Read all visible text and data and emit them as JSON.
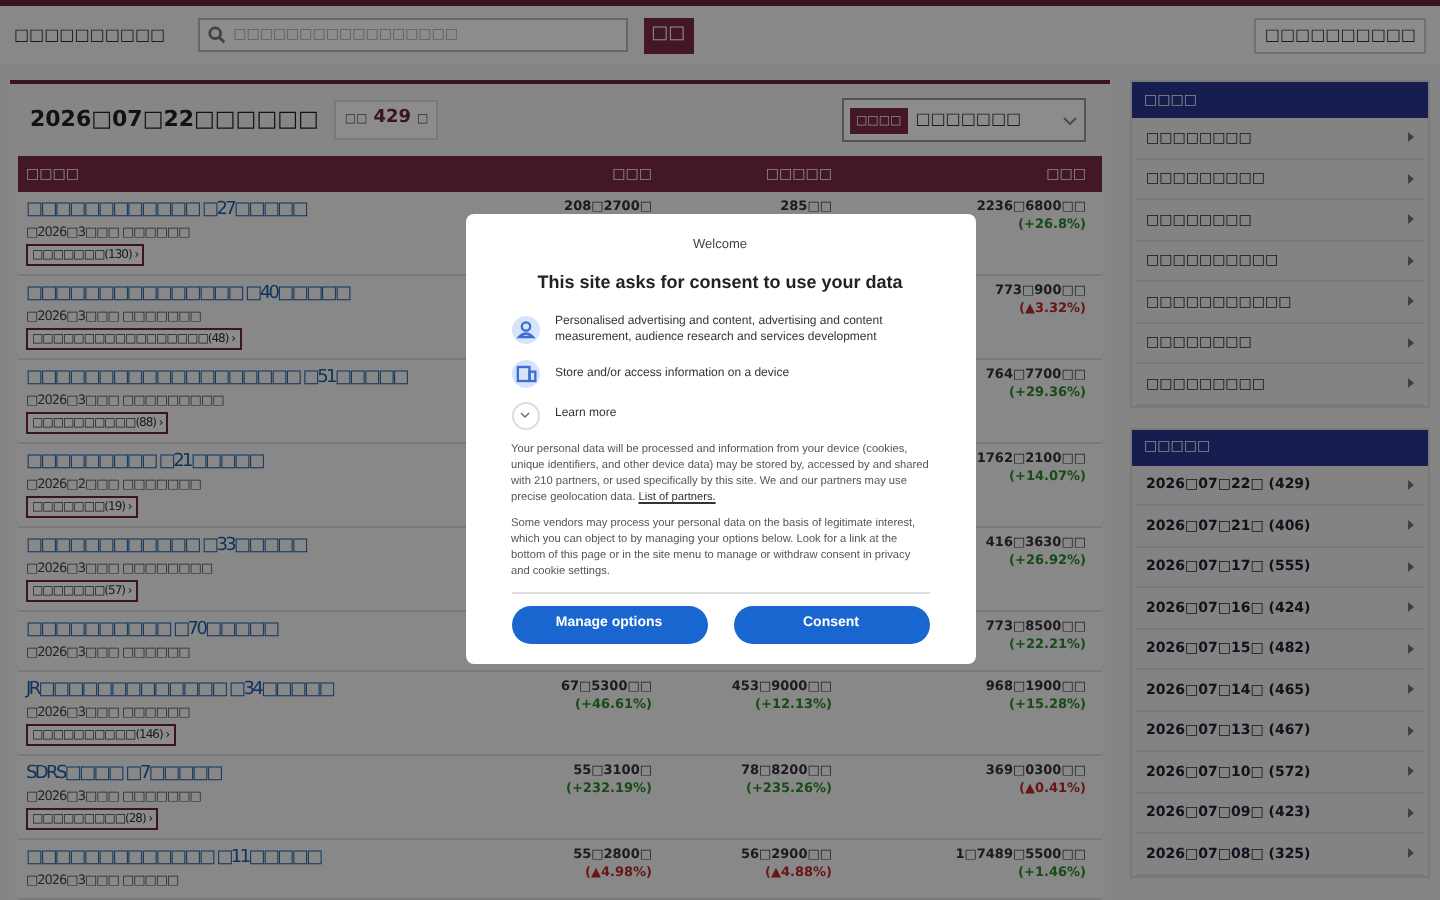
{
  "header": {
    "logo": "□□□□□□□□□□",
    "search": {
      "placeholder": "□□□□□□□□□□□□□□□□□"
    },
    "search_button": "□□",
    "top_link": "□□□□□□□□□□"
  },
  "panel": {
    "title": "2026□07□22□□□□□□",
    "count_prefix": "□□",
    "count": "429",
    "count_suffix": "□",
    "sort": {
      "label": "□□□□",
      "value": "□□□□□□□"
    }
  },
  "table": {
    "columns": [
      "□□□□",
      "□□□",
      "□□□□□",
      "□□□"
    ],
    "rows": [
      {
        "cells": [
          {
            "name": "□□□□□□□□□□□□ □27□□□□□",
            "date": "□2026□3□□□ □□□□□□",
            "tag": "□□□□□□□(130) ›"
          },
          {
            "value": "208□2700□"
          },
          {
            "value": "285□□"
          },
          {
            "value": "2236□6800□□",
            "change": "(+26.8%)",
            "kind": "up"
          }
        ]
      },
      {
        "cells": [
          {
            "name": "□□□□□□□□□□□□□□□ □40□□□□□",
            "date": "□2026□3□□□ □□□□□□□",
            "tag": "□□□□□□□□□□□□□□□□□(48) ›"
          },
          null,
          null,
          {
            "value": "773□900□□",
            "change": "(▲3.32%)",
            "kind": "down"
          }
        ]
      },
      {
        "cells": [
          {
            "name": "□□□□□□□□□□□□□□□□□□□ □51□□□□□",
            "date": "□2026□3□□□ □□□□□□□□□",
            "tag": "□□□□□□□□□□(88) ›"
          },
          null,
          null,
          {
            "value": "764□7700□□",
            "change": "(+29.36%)",
            "kind": "up"
          }
        ]
      },
      {
        "cells": [
          {
            "name": "□□□□□□□□□ □21□□□□□",
            "date": "□2026□2□□□ □□□□□□□",
            "tag": "□□□□□□□(19) ›"
          },
          null,
          null,
          {
            "value": "1762□2100□□",
            "change": "(+14.07%)",
            "kind": "up"
          }
        ]
      },
      {
        "cells": [
          {
            "name": "□□□□□□□□□□□□ □33□□□□□",
            "date": "□2026□3□□□ □□□□□□□□",
            "tag": "□□□□□□□(57) ›"
          },
          null,
          null,
          {
            "value": "416□3630□□",
            "change": "(+26.92%)",
            "kind": "up"
          }
        ]
      },
      {
        "cells": [
          {
            "name": "□□□□□□□□□□ □70□□□□□",
            "date": "□2026□3□□□ □□□□□□"
          },
          null,
          null,
          {
            "value": "773□8500□□",
            "change": "(+22.21%)",
            "kind": "up"
          }
        ]
      },
      {
        "cells": [
          {
            "name": "JR□□□□□□□□□□□□□ □34□□□□□",
            "date": "□2026□3□□□ □□□□□□",
            "tag": "□□□□□□□□□□(146) ›"
          },
          {
            "value": "67□5300□□",
            "change": "(+46.61%)",
            "kind": "up"
          },
          {
            "value": "453□9000□□",
            "change": "(+12.13%)",
            "kind": "up"
          },
          {
            "value": "968□1900□□",
            "change": "(+15.28%)",
            "kind": "up"
          }
        ]
      },
      {
        "cells": [
          {
            "name": "SDRS□□□□ □7□□□□□",
            "date": "□2026□3□□□ □□□□□□□",
            "tag": "□□□□□□□□□(28) ›"
          },
          {
            "value": "55□3100□",
            "change": "(+232.19%)",
            "kind": "up"
          },
          {
            "value": "78□8200□□",
            "change": "(+235.26%)",
            "kind": "up"
          },
          {
            "value": "369□0300□□",
            "change": "(▲0.41%)",
            "kind": "down"
          }
        ]
      },
      {
        "cells": [
          {
            "name": "□□□□□□□□□□□□□ □11□□□□□",
            "date": "□2026□3□□□ □□□□□"
          },
          {
            "value": "55□2800□",
            "change": "(▲4.98%)",
            "kind": "down"
          },
          {
            "value": "56□2900□□",
            "change": "(▲4.88%)",
            "kind": "down"
          },
          {
            "value": "1□7489□5500□□",
            "change": "(+1.46%)",
            "kind": "up"
          }
        ]
      }
    ]
  },
  "sidebar": {
    "categories": {
      "title": "□□□□",
      "items": [
        "□□□□□□□□",
        "□□□□□□□□□",
        "□□□□□□□□",
        "□□□□□□□□□□",
        "□□□□□□□□□□□",
        "□□□□□□□□",
        "□□□□□□□□□"
      ]
    },
    "dates": {
      "title": "□□□□□",
      "items": [
        "2026□07□22□ (429)",
        "2026□07□21□ (406)",
        "2026□07□17□ (555)",
        "2026□07□16□ (424)",
        "2026□07□15□ (482)",
        "2026□07□14□ (465)",
        "2026□07□13□ (467)",
        "2026□07□10□ (572)",
        "2026□07□09□ (423)",
        "2026□07□08□ (325)"
      ]
    }
  },
  "consent": {
    "welcome": "Welcome",
    "title": "This site asks for consent to use your data",
    "purposes": [
      {
        "kind": "person",
        "text": "Personalised advertising and content, advertising and content measurement, audience research and services development"
      },
      {
        "kind": "device",
        "text": "Store and/or access information on a device"
      }
    ],
    "learn_more": "Learn more",
    "paragraph_1": "Your personal data will be processed and information from your device (cookies, unique identifiers, and other device data) may be stored by, accessed by and shared with 210 partners, or used specifically by this site. We and our partners may use precise geolocation data.",
    "partners_link": "List of partners.",
    "paragraph_2": "Some vendors may process your personal data on the basis of legitimate interest, which you can object to by managing your options below. Look for a link at the bottom of this page or in the site menu to manage or withdraw consent in privacy and cookie settings.",
    "buttons": [
      "Manage options",
      "Consent"
    ]
  }
}
